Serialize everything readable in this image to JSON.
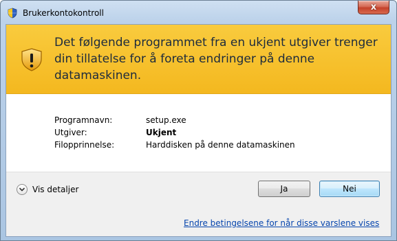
{
  "window": {
    "title": "Brukerkontokontroll",
    "close_label": "x"
  },
  "banner": {
    "headline": "Det følgende programmet fra en ukjent utgiver trenger din tillatelse for å foreta endringer på denne datamaskinen.",
    "color": "#f6c12c"
  },
  "details": {
    "rows": [
      {
        "label": "Programnavn:",
        "value": "setup.exe"
      },
      {
        "label": "Utgiver:",
        "value": "Ukjent"
      },
      {
        "label": "Filopprinnelse:",
        "value": "Harddisken på denne datamaskinen"
      }
    ]
  },
  "footer": {
    "show_details_label": "Vis detaljer",
    "yes_label": "Ja",
    "no_label": "Nei",
    "settings_link": "Endre betingelsene for når disse varslene vises"
  },
  "icons": {
    "title_icon": "uac-shield-icon",
    "banner_icon": "warning-shield-icon",
    "toggle_icon": "chevron-down-icon"
  }
}
